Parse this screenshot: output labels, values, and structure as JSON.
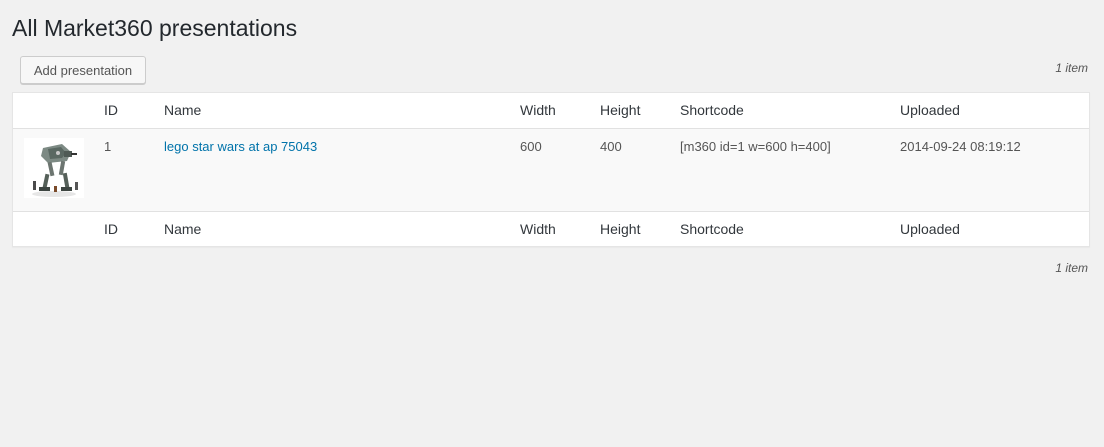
{
  "page": {
    "title": "All Market360 presentations",
    "add_button_label": "Add presentation",
    "item_count": "1 item"
  },
  "table": {
    "headers": {
      "id": "ID",
      "name": "Name",
      "width": "Width",
      "height": "Height",
      "shortcode": "Shortcode",
      "uploaded": "Uploaded"
    },
    "rows": [
      {
        "thumbnail_icon": "lego-walker-thumbnail-icon",
        "id": "1",
        "name": "lego star wars at ap 75043",
        "width": "600",
        "height": "400",
        "shortcode": "[m360 id=1 w=600 h=400]",
        "uploaded": "2014-09-24 08:19:12"
      }
    ]
  },
  "colors": {
    "background": "#f1f1f1",
    "link": "#0073aa",
    "row_alt": "#f9f9f9"
  }
}
